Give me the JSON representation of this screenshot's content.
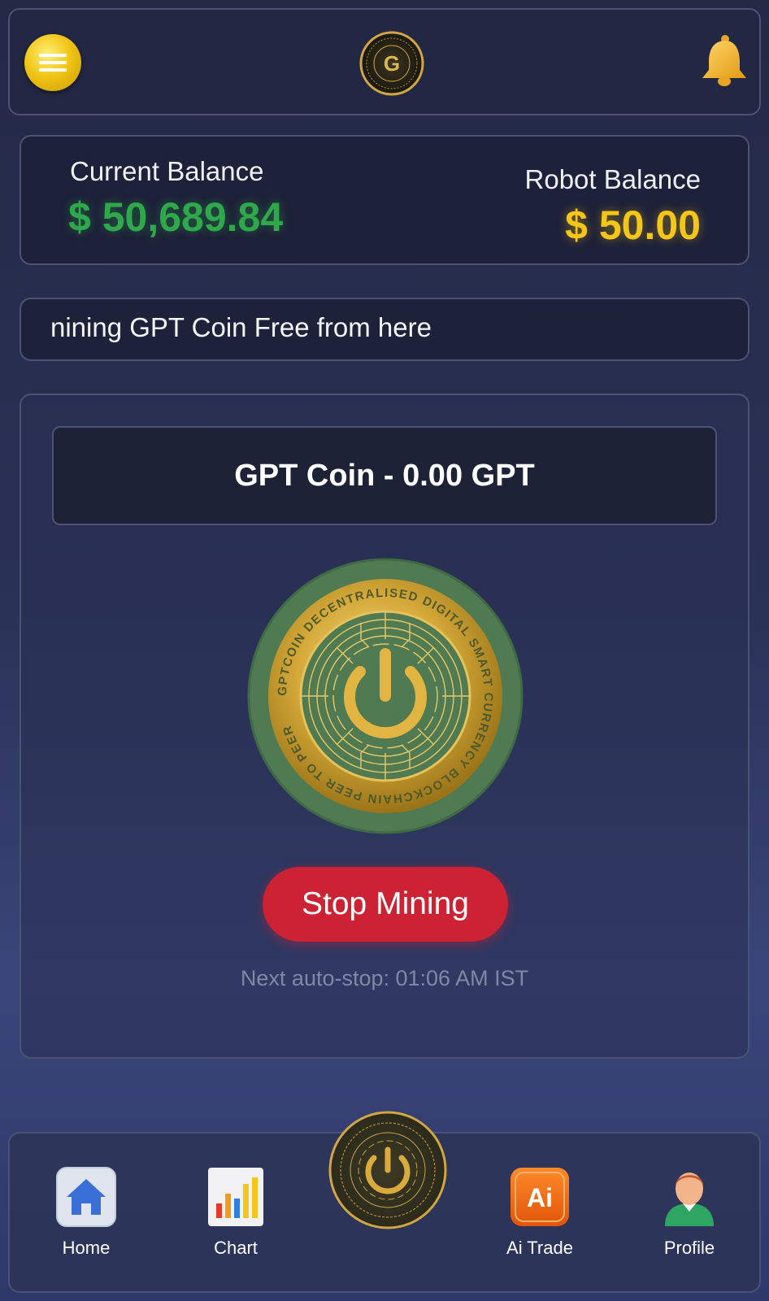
{
  "header": {
    "menu_icon": "hamburger-menu-icon",
    "logo_letter": "G",
    "bell_icon": "bell-icon"
  },
  "balances": {
    "current_label": "Current Balance",
    "current_value": "$ 50,689.84",
    "robot_label": "Robot Balance",
    "robot_value": "$ 50.00"
  },
  "marquee": {
    "text": "nining GPT Coin Free from here"
  },
  "mining": {
    "coin_balance": "GPT Coin - 0.00 GPT",
    "coin_ring_text": "GPTCOIN DECENTRALISED DIGITAL SMART CURRENCY BLOCKCHAIN PEER TO PEER",
    "stop_label": "Stop Mining",
    "auto_stop_text": "Next auto-stop: 01:06 AM IST"
  },
  "nav": {
    "items": [
      {
        "label": "Home",
        "icon": "home-icon"
      },
      {
        "label": "Chart",
        "icon": "bar-chart-icon"
      },
      {
        "label": "",
        "icon": "gptcoin-icon"
      },
      {
        "label": "Ai Trade",
        "icon": "ai-trade-icon"
      },
      {
        "label": "Profile",
        "icon": "profile-icon"
      }
    ],
    "ai_badge": "Ai"
  },
  "colors": {
    "current_balance": "#2ea84a",
    "robot_balance": "#f5c518",
    "stop_button": "#cc2233",
    "menu_button": "#f1c515"
  }
}
